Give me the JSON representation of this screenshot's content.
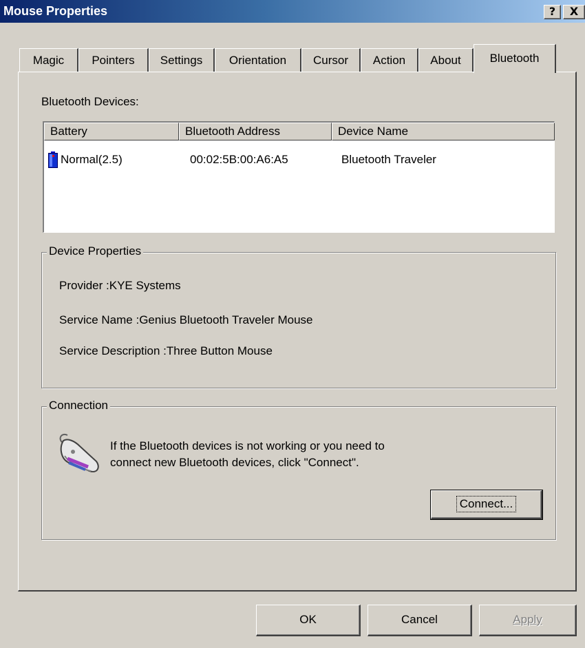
{
  "window": {
    "title": "Mouse Properties",
    "help_label": "?",
    "close_label": "X"
  },
  "tabs": [
    {
      "label": "Magic"
    },
    {
      "label": "Pointers"
    },
    {
      "label": "Settings"
    },
    {
      "label": "Orientation"
    },
    {
      "label": "Cursor"
    },
    {
      "label": "Action"
    },
    {
      "label": "About"
    },
    {
      "label": "Bluetooth",
      "active": true
    }
  ],
  "bluetooth": {
    "devices_label": "Bluetooth Devices:",
    "columns": [
      "Battery",
      "Bluetooth Address",
      "Device Name"
    ],
    "rows": [
      {
        "battery": "Normal(2.5)",
        "address": "00:02:5B:00:A6:A5",
        "name": "Bluetooth Traveler"
      }
    ],
    "battery_icon": "battery-icon"
  },
  "device_properties": {
    "legend": "Device Properties",
    "provider": "Provider :KYE Systems",
    "service_name": "Service Name :Genius Bluetooth Traveler Mouse",
    "service_description": "Service Description :Three Button Mouse"
  },
  "connection": {
    "legend": "Connection",
    "message_line1": "If the Bluetooth devices is not working or you need to",
    "message_line2": "connect new Bluetooth devices, click \"Connect\".",
    "connect_button": "Connect...",
    "icon": "mouse-icon"
  },
  "footer": {
    "ok": "OK",
    "cancel": "Cancel",
    "apply": "Apply"
  },
  "colors": {
    "face": "#d4d0c8",
    "title_start": "#0a246a",
    "title_end": "#a6caf0"
  }
}
